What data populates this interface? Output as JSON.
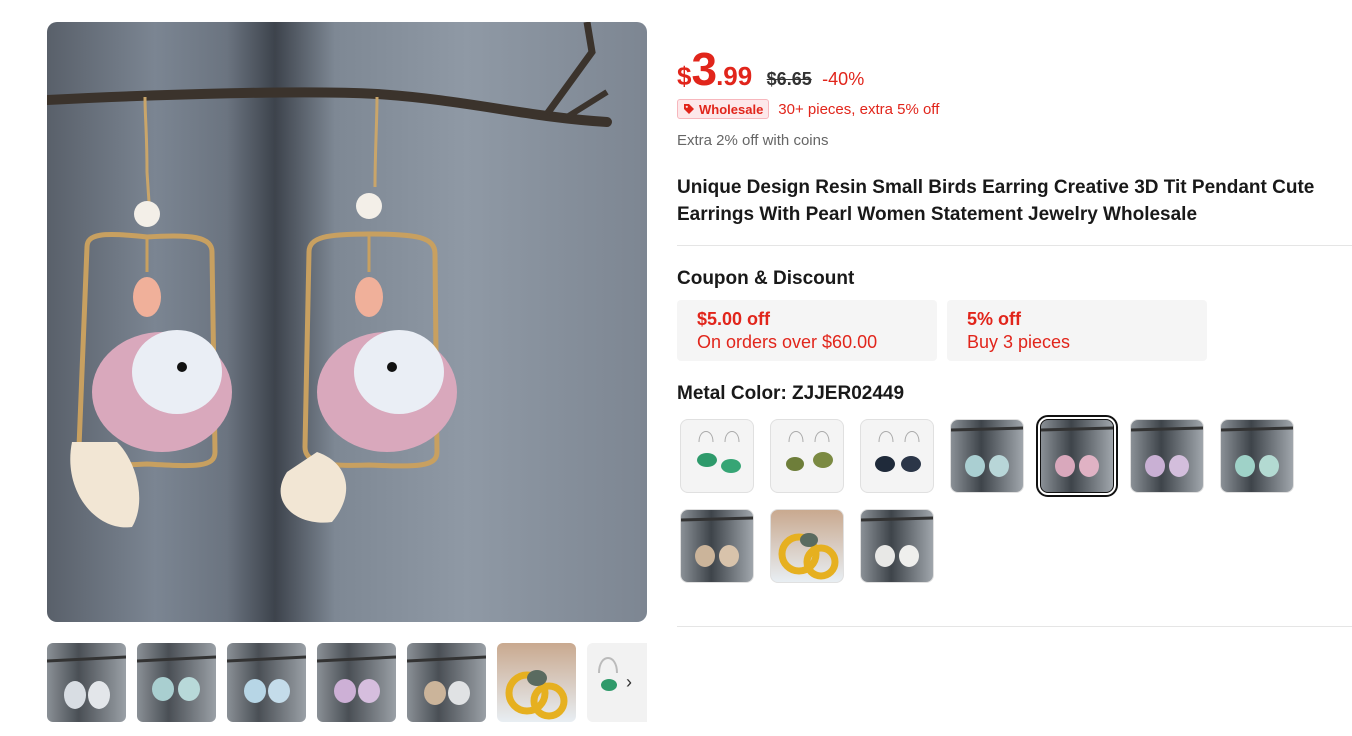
{
  "gallery": {
    "thumbnail_count": 7,
    "next_icon": "chevron-right-icon"
  },
  "price": {
    "currency": "$",
    "integer": "3",
    "decimal": ".99",
    "original": "$6.65",
    "discount": "-40%"
  },
  "wholesale": {
    "icon": "tag-icon",
    "badge": "Wholesale",
    "text": "30+ pieces, extra 5% off"
  },
  "coins_text": "Extra 2% off with coins",
  "product_title": "Unique Design Resin Small Birds Earring Creative 3D Tit Pendant Cute Earrings With Pearl Women Statement Jewelry Wholesale",
  "coupons": {
    "heading": "Coupon & Discount",
    "items": [
      {
        "amount": "$5.00 off",
        "condition": "On orders over $60.00"
      },
      {
        "amount": "5% off",
        "condition": "Buy 3 pieces"
      }
    ]
  },
  "variants": {
    "label": "Metal Color: ZJJER02449",
    "selected_index": 4,
    "count": 10
  },
  "colors": {
    "accent_red": "#e1251b",
    "badge_bg": "#fde8ea",
    "coupon_bg": "#f5f5f5"
  }
}
